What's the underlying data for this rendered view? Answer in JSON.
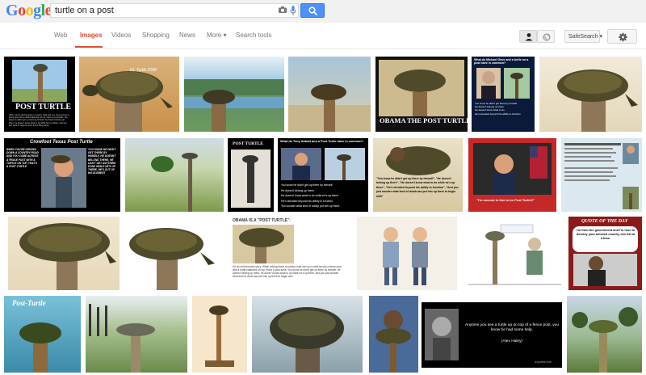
{
  "search": {
    "query": "turtle on a post"
  },
  "logo": {
    "letters": [
      "G",
      "o",
      "o",
      "g",
      "l",
      "e"
    ],
    "colors": [
      "#4285f4",
      "#ea4335",
      "#fbbc05",
      "#4285f4",
      "#34a853",
      "#ea4335"
    ]
  },
  "tabs": [
    {
      "label": "Web"
    },
    {
      "label": "Images"
    },
    {
      "label": "Videos"
    },
    {
      "label": "Shopping"
    },
    {
      "label": "News"
    },
    {
      "label": "More ▾"
    },
    {
      "label": "Search tools"
    }
  ],
  "toolbar": {
    "safesearch_label": "SafeSearch ▾"
  },
  "captions": {
    "post_turtle": "POST TURTLE",
    "post_turtle_body": "When you're driving down a country road and you come across a fence post with a turtle balanced on top, that's a post turtle. You know he didn't get up there by himself, he doesn't belong up there, he doesn't know what to do while he's up there, and you just want to help the poor dumb thing down.",
    "obama_post_turtle": "OBAMA THE POST TURTLE",
    "gove_title": "What do Michael Gove and a turtle on a post have in common?",
    "gove_points": [
      "You know he didn't get there by himself",
      "He doesn't belong up there",
      "He doesn't know what to do",
      "He's elevated beyond his ability to function"
    ],
    "crowfoot": "Crowfoot Texas Post Turtle",
    "crowfoot_left": "WHEN YOU'RE DRIVING DOWN A COUNTRY ROAD AND YOU COME ACROSS A FENCE POST WITH A TURTLE ON TOP, THAT'S A POST TURTLE",
    "crowfoot_right": "YOU KNOW HE DIDN'T GET THERE BY HIMSELF, HE DOESN'T BELONG THERE, HE CAN'T GET ANYTHING DONE WHILE HE'S UP THERE, HE'S OUT OF HIS ELEMENT",
    "post_turtle_book": "POST TURTLE",
    "abbott_title": "What do Tony Abbott and a Post Turtle have in common?",
    "abbott_points": [
      "You know he didn't get up there by himself.",
      "He doesn't belong up there.",
      "He doesn't know what to do while he's up there.",
      "He's elevated beyond his ability to function.",
      "You wonder what kind of noddy put him up there."
    ],
    "obama_turtle_text": "\"You know he didn't get up there by himself\", \"He doesn't belong up there\", \"He doesn't know what to do while he's up there\", \"He's elevated beyond his ability to function\", \"And you just wonder what kind of dumb ass put him up there to begin with\"",
    "second_in_line": "\"I'm second in line to be Post Turtle!!\"",
    "obama_is_post_turtle": "OBAMA IS A \"POST TURTLE\":",
    "obama_is_body": "It's an old Kentucky story. When driving down a country road and you come across a fence post with a turtle balanced on top, that's a post turtle. You know he didn't get up there by himself, he doesn't belong up there, he doesn't know what to do while he's up there, and you just wonder what kind of dumb ass put him up there to begin with.",
    "quote_of_the_day": "QUOTE OF THE DAY",
    "quote_body": "I'm from the government and I'm here to destroy your beloved country one bill at a time.",
    "post_turtle_script": "Post-Turtle",
    "haley_quote": "Anytime you see a turtle up on top of a fence post, you know he had some help.",
    "haley_attrib": "(Alex Haley)",
    "quotes_domain": "izquotes.com",
    "dr_turtle": "Dr. Turtle 2008"
  }
}
